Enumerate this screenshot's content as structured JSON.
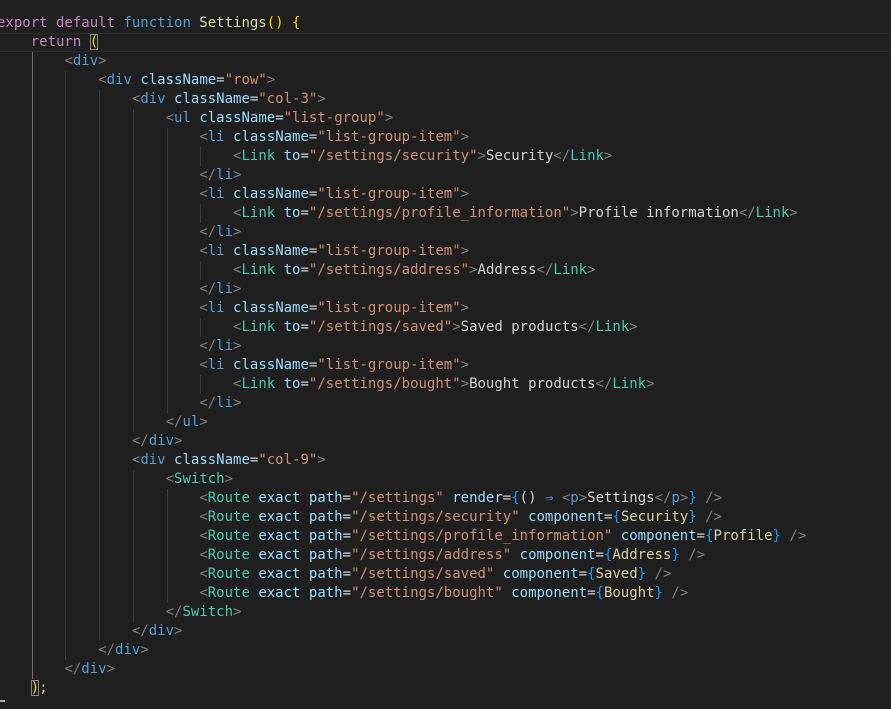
{
  "editor": {
    "current_line": 1,
    "lines": [
      {
        "indent": 0,
        "tokens": [
          [
            "kw",
            "export default "
          ],
          [
            "fn",
            "function "
          ],
          [
            "fname",
            "Settings"
          ],
          [
            "br1",
            "() {"
          ]
        ]
      },
      {
        "indent": 1,
        "tokens": [
          [
            "kw",
            "return "
          ],
          [
            "br1 match",
            "("
          ]
        ]
      },
      {
        "indent": 2,
        "tokens": [
          [
            "tb",
            "<"
          ],
          [
            "tag",
            "div"
          ],
          [
            "tb",
            ">"
          ]
        ]
      },
      {
        "indent": 3,
        "tokens": [
          [
            "tb",
            "<"
          ],
          [
            "tag",
            "div "
          ],
          [
            "attr",
            "className"
          ],
          [
            "punc",
            "="
          ],
          [
            "str",
            "\"row\""
          ],
          [
            "tb",
            ">"
          ]
        ]
      },
      {
        "indent": 4,
        "tokens": [
          [
            "tb",
            "<"
          ],
          [
            "tag",
            "div "
          ],
          [
            "attr",
            "className"
          ],
          [
            "punc",
            "="
          ],
          [
            "str",
            "\"col-3\""
          ],
          [
            "tb",
            ">"
          ]
        ]
      },
      {
        "indent": 5,
        "tokens": [
          [
            "tb",
            "<"
          ],
          [
            "tag",
            "ul "
          ],
          [
            "attr",
            "className"
          ],
          [
            "punc",
            "="
          ],
          [
            "str",
            "\"list-group\""
          ],
          [
            "tb",
            ">"
          ]
        ]
      },
      {
        "indent": 6,
        "tokens": [
          [
            "tb",
            "<"
          ],
          [
            "tag",
            "li "
          ],
          [
            "attr",
            "className"
          ],
          [
            "punc",
            "="
          ],
          [
            "str",
            "\"list-group-item\""
          ],
          [
            "tb",
            ">"
          ]
        ]
      },
      {
        "indent": 7,
        "tokens": [
          [
            "tb",
            "<"
          ],
          [
            "comp",
            "Link "
          ],
          [
            "attr",
            "to"
          ],
          [
            "punc",
            "="
          ],
          [
            "str",
            "\"/settings/security\""
          ],
          [
            "tb",
            ">"
          ],
          [
            "txt",
            "Security"
          ],
          [
            "tb",
            "</"
          ],
          [
            "comp",
            "Link"
          ],
          [
            "tb",
            ">"
          ]
        ]
      },
      {
        "indent": 6,
        "tokens": [
          [
            "tb",
            "</"
          ],
          [
            "tag",
            "li"
          ],
          [
            "tb",
            ">"
          ]
        ]
      },
      {
        "indent": 6,
        "tokens": [
          [
            "tb",
            "<"
          ],
          [
            "tag",
            "li "
          ],
          [
            "attr",
            "className"
          ],
          [
            "punc",
            "="
          ],
          [
            "str",
            "\"list-group-item\""
          ],
          [
            "tb",
            ">"
          ]
        ]
      },
      {
        "indent": 7,
        "tokens": [
          [
            "tb",
            "<"
          ],
          [
            "comp",
            "Link "
          ],
          [
            "attr",
            "to"
          ],
          [
            "punc",
            "="
          ],
          [
            "str",
            "\"/settings/profile_information\""
          ],
          [
            "tb",
            ">"
          ],
          [
            "txt",
            "Profile information"
          ],
          [
            "tb",
            "</"
          ],
          [
            "comp",
            "Link"
          ],
          [
            "tb",
            ">"
          ]
        ]
      },
      {
        "indent": 6,
        "tokens": [
          [
            "tb",
            "</"
          ],
          [
            "tag",
            "li"
          ],
          [
            "tb",
            ">"
          ]
        ]
      },
      {
        "indent": 6,
        "tokens": [
          [
            "tb",
            "<"
          ],
          [
            "tag",
            "li "
          ],
          [
            "attr",
            "className"
          ],
          [
            "punc",
            "="
          ],
          [
            "str",
            "\"list-group-item\""
          ],
          [
            "tb",
            ">"
          ]
        ]
      },
      {
        "indent": 7,
        "tokens": [
          [
            "tb",
            "<"
          ],
          [
            "comp",
            "Link "
          ],
          [
            "attr",
            "to"
          ],
          [
            "punc",
            "="
          ],
          [
            "str",
            "\"/settings/address\""
          ],
          [
            "tb",
            ">"
          ],
          [
            "txt",
            "Address"
          ],
          [
            "tb",
            "</"
          ],
          [
            "comp",
            "Link"
          ],
          [
            "tb",
            ">"
          ]
        ]
      },
      {
        "indent": 6,
        "tokens": [
          [
            "tb",
            "</"
          ],
          [
            "tag",
            "li"
          ],
          [
            "tb",
            ">"
          ]
        ]
      },
      {
        "indent": 6,
        "tokens": [
          [
            "tb",
            "<"
          ],
          [
            "tag",
            "li "
          ],
          [
            "attr",
            "className"
          ],
          [
            "punc",
            "="
          ],
          [
            "str",
            "\"list-group-item\""
          ],
          [
            "tb",
            ">"
          ]
        ]
      },
      {
        "indent": 7,
        "tokens": [
          [
            "tb",
            "<"
          ],
          [
            "comp",
            "Link "
          ],
          [
            "attr",
            "to"
          ],
          [
            "punc",
            "="
          ],
          [
            "str",
            "\"/settings/saved\""
          ],
          [
            "tb",
            ">"
          ],
          [
            "txt",
            "Saved products"
          ],
          [
            "tb",
            "</"
          ],
          [
            "comp",
            "Link"
          ],
          [
            "tb",
            ">"
          ]
        ]
      },
      {
        "indent": 6,
        "tokens": [
          [
            "tb",
            "</"
          ],
          [
            "tag",
            "li"
          ],
          [
            "tb",
            ">"
          ]
        ]
      },
      {
        "indent": 6,
        "tokens": [
          [
            "tb",
            "<"
          ],
          [
            "tag",
            "li "
          ],
          [
            "attr",
            "className"
          ],
          [
            "punc",
            "="
          ],
          [
            "str",
            "\"list-group-item\""
          ],
          [
            "tb",
            ">"
          ]
        ]
      },
      {
        "indent": 7,
        "tokens": [
          [
            "tb",
            "<"
          ],
          [
            "comp",
            "Link "
          ],
          [
            "attr",
            "to"
          ],
          [
            "punc",
            "="
          ],
          [
            "str",
            "\"/settings/bought\""
          ],
          [
            "tb",
            ">"
          ],
          [
            "txt",
            "Bought products"
          ],
          [
            "tb",
            "</"
          ],
          [
            "comp",
            "Link"
          ],
          [
            "tb",
            ">"
          ]
        ]
      },
      {
        "indent": 6,
        "tokens": [
          [
            "tb",
            "</"
          ],
          [
            "tag",
            "li"
          ],
          [
            "tb",
            ">"
          ]
        ]
      },
      {
        "indent": 5,
        "tokens": [
          [
            "tb",
            "</"
          ],
          [
            "tag",
            "ul"
          ],
          [
            "tb",
            ">"
          ]
        ]
      },
      {
        "indent": 4,
        "tokens": [
          [
            "tb",
            "</"
          ],
          [
            "tag",
            "div"
          ],
          [
            "tb",
            ">"
          ]
        ]
      },
      {
        "indent": 4,
        "tokens": [
          [
            "tb",
            "<"
          ],
          [
            "tag",
            "div "
          ],
          [
            "attr",
            "className"
          ],
          [
            "punc",
            "="
          ],
          [
            "str",
            "\"col-9\""
          ],
          [
            "tb",
            ">"
          ]
        ]
      },
      {
        "indent": 5,
        "tokens": [
          [
            "tb",
            "<"
          ],
          [
            "comp",
            "Switch"
          ],
          [
            "tb",
            ">"
          ]
        ]
      },
      {
        "indent": 6,
        "tokens": [
          [
            "tb",
            "<"
          ],
          [
            "comp",
            "Route "
          ],
          [
            "attr",
            "exact path"
          ],
          [
            "punc",
            "="
          ],
          [
            "str",
            "\"/settings\" "
          ],
          [
            "attr",
            "render"
          ],
          [
            "punc",
            "="
          ],
          [
            "br2",
            "{"
          ],
          [
            "punc",
            "() "
          ],
          [
            "arrow",
            "⇒ "
          ],
          [
            "tb",
            "<"
          ],
          [
            "tag",
            "p"
          ],
          [
            "tb",
            ">"
          ],
          [
            "txt",
            "Settings"
          ],
          [
            "tb",
            "</"
          ],
          [
            "tag",
            "p"
          ],
          [
            "tb",
            ">"
          ],
          [
            "br2",
            "}"
          ],
          [
            "tb",
            " />"
          ]
        ]
      },
      {
        "indent": 6,
        "tokens": [
          [
            "tb",
            "<"
          ],
          [
            "comp",
            "Route "
          ],
          [
            "attr",
            "exact path"
          ],
          [
            "punc",
            "="
          ],
          [
            "str",
            "\"/settings/security\" "
          ],
          [
            "attr",
            "component"
          ],
          [
            "punc",
            "="
          ],
          [
            "br2",
            "{"
          ],
          [
            "ident",
            "Security"
          ],
          [
            "br2",
            "}"
          ],
          [
            "tb",
            " />"
          ]
        ]
      },
      {
        "indent": 6,
        "tokens": [
          [
            "tb",
            "<"
          ],
          [
            "comp",
            "Route "
          ],
          [
            "attr",
            "exact path"
          ],
          [
            "punc",
            "="
          ],
          [
            "str",
            "\"/settings/profile_information\" "
          ],
          [
            "attr",
            "component"
          ],
          [
            "punc",
            "="
          ],
          [
            "br2",
            "{"
          ],
          [
            "ident",
            "Profile"
          ],
          [
            "br2",
            "}"
          ],
          [
            "tb",
            " />"
          ]
        ]
      },
      {
        "indent": 6,
        "tokens": [
          [
            "tb",
            "<"
          ],
          [
            "comp",
            "Route "
          ],
          [
            "attr",
            "exact path"
          ],
          [
            "punc",
            "="
          ],
          [
            "str",
            "\"/settings/address\" "
          ],
          [
            "attr",
            "component"
          ],
          [
            "punc",
            "="
          ],
          [
            "br2",
            "{"
          ],
          [
            "ident",
            "Address"
          ],
          [
            "br2",
            "}"
          ],
          [
            "tb",
            " />"
          ]
        ]
      },
      {
        "indent": 6,
        "tokens": [
          [
            "tb",
            "<"
          ],
          [
            "comp",
            "Route "
          ],
          [
            "attr",
            "exact path"
          ],
          [
            "punc",
            "="
          ],
          [
            "str",
            "\"/settings/saved\" "
          ],
          [
            "attr",
            "component"
          ],
          [
            "punc",
            "="
          ],
          [
            "br2",
            "{"
          ],
          [
            "ident",
            "Saved"
          ],
          [
            "br2",
            "}"
          ],
          [
            "tb",
            " />"
          ]
        ]
      },
      {
        "indent": 6,
        "tokens": [
          [
            "tb",
            "<"
          ],
          [
            "comp",
            "Route "
          ],
          [
            "attr",
            "exact path"
          ],
          [
            "punc",
            "="
          ],
          [
            "str",
            "\"/settings/bought\" "
          ],
          [
            "attr",
            "component"
          ],
          [
            "punc",
            "="
          ],
          [
            "br2",
            "{"
          ],
          [
            "ident",
            "Bought"
          ],
          [
            "br2",
            "}"
          ],
          [
            "tb",
            " />"
          ]
        ]
      },
      {
        "indent": 5,
        "tokens": [
          [
            "tb",
            "</"
          ],
          [
            "comp",
            "Switch"
          ],
          [
            "tb",
            ">"
          ]
        ]
      },
      {
        "indent": 4,
        "tokens": [
          [
            "tb",
            "</"
          ],
          [
            "tag",
            "div"
          ],
          [
            "tb",
            ">"
          ]
        ]
      },
      {
        "indent": 3,
        "tokens": [
          [
            "tb",
            "</"
          ],
          [
            "tag",
            "div"
          ],
          [
            "tb",
            ">"
          ]
        ]
      },
      {
        "indent": 2,
        "tokens": [
          [
            "tb",
            "</"
          ],
          [
            "tag",
            "div"
          ],
          [
            "tb",
            ">"
          ]
        ]
      },
      {
        "indent": 1,
        "tokens": [
          [
            "br1 match",
            ")"
          ],
          [
            "punc",
            ";"
          ]
        ]
      }
    ]
  }
}
